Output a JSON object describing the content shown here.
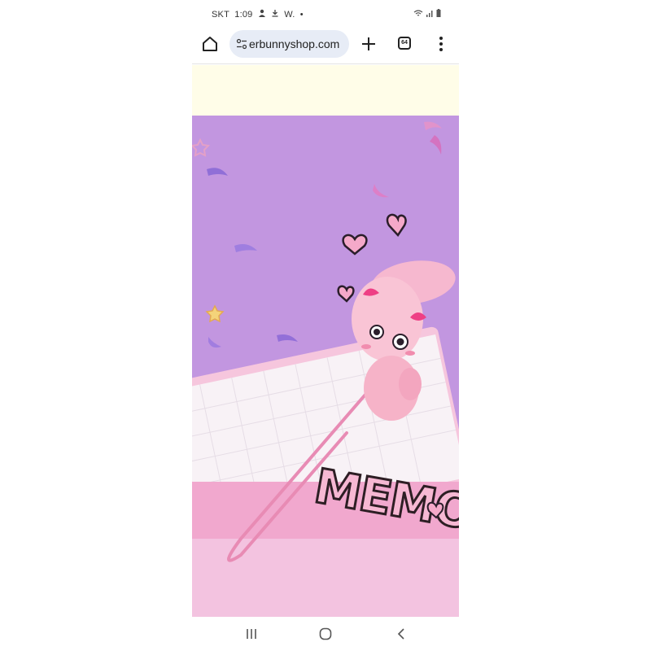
{
  "statusbar": {
    "carrier": "SKT",
    "time": "1:09",
    "notification_icons": [
      "person-icon",
      "download-icon"
    ],
    "notif_text": "W.",
    "dot": "•",
    "right_icons": [
      "wifi-icon",
      "signal-icon",
      "battery-icon"
    ]
  },
  "browser": {
    "url": "erbunnyshop.com",
    "tab_count": "64"
  },
  "product": {
    "memo_text": "MEMO"
  },
  "colors": {
    "background_purple": "#c69ae3",
    "banner": "#fffde8",
    "url_pill": "#e7ecf6",
    "pink": "#f5b9cf",
    "bow": "#ee3f85"
  },
  "icons": {
    "navbar": [
      "recents-icon",
      "home-circle-icon",
      "back-icon"
    ]
  }
}
